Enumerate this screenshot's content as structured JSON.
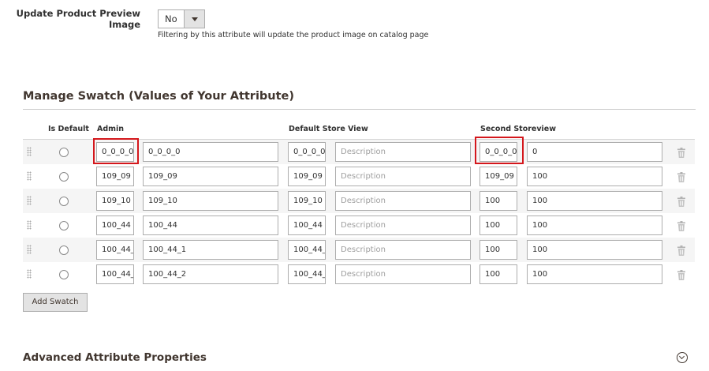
{
  "preview": {
    "label": "Update Product Preview Image",
    "value": "No",
    "note": "Filtering by this attribute will update the product image on catalog page"
  },
  "section_title": "Manage Swatch (Values of Your Attribute)",
  "columns": {
    "is_default": "Is Default",
    "admin": "Admin",
    "default_store_view": "Default Store View",
    "second_storeview": "Second Storeview"
  },
  "rows": [
    {
      "admin_code": "0_0_0_0",
      "admin_label": "0_0_0_0",
      "default_code": "0_0_0_0",
      "default_desc": "Description",
      "second_code": "0_0_0_0",
      "second_label": "0"
    },
    {
      "admin_code": "109_09",
      "admin_label": "109_09",
      "default_code": "109_09",
      "default_desc": "Description",
      "second_code": "109_09",
      "second_label": "100"
    },
    {
      "admin_code": "109_10",
      "admin_label": "109_10",
      "default_code": "109_10",
      "default_desc": "Description",
      "second_code": "100",
      "second_label": "100"
    },
    {
      "admin_code": "100_44",
      "admin_label": "100_44",
      "default_code": "100_44",
      "default_desc": "Description",
      "second_code": "100",
      "second_label": "100"
    },
    {
      "admin_code": "100_44_",
      "admin_label": "100_44_1",
      "default_code": "100_44_",
      "default_desc": "Description",
      "second_code": "100",
      "second_label": "100"
    },
    {
      "admin_code": "100_44_",
      "admin_label": "100_44_2",
      "default_code": "100_44_",
      "default_desc": "Description",
      "second_code": "100",
      "second_label": "100"
    }
  ],
  "add_swatch_label": "Add Swatch",
  "advanced_title": "Advanced Attribute Properties",
  "highlight_color": "#d4171c"
}
